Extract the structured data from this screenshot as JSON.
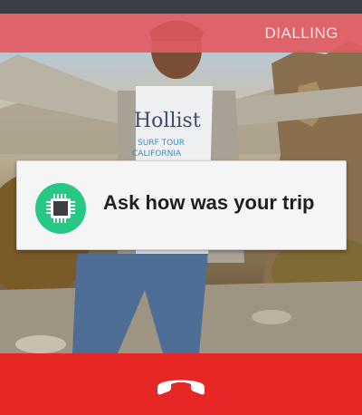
{
  "call": {
    "status": "DIALLING"
  },
  "prompt_card": {
    "text": "Ask how was your trip",
    "icon": "chip-icon"
  },
  "end_call": {
    "icon": "end-call-phone-icon"
  },
  "colors": {
    "dial_bar": "#e25c62",
    "end_bar": "#e72726",
    "chip_circle": "#27c883"
  }
}
